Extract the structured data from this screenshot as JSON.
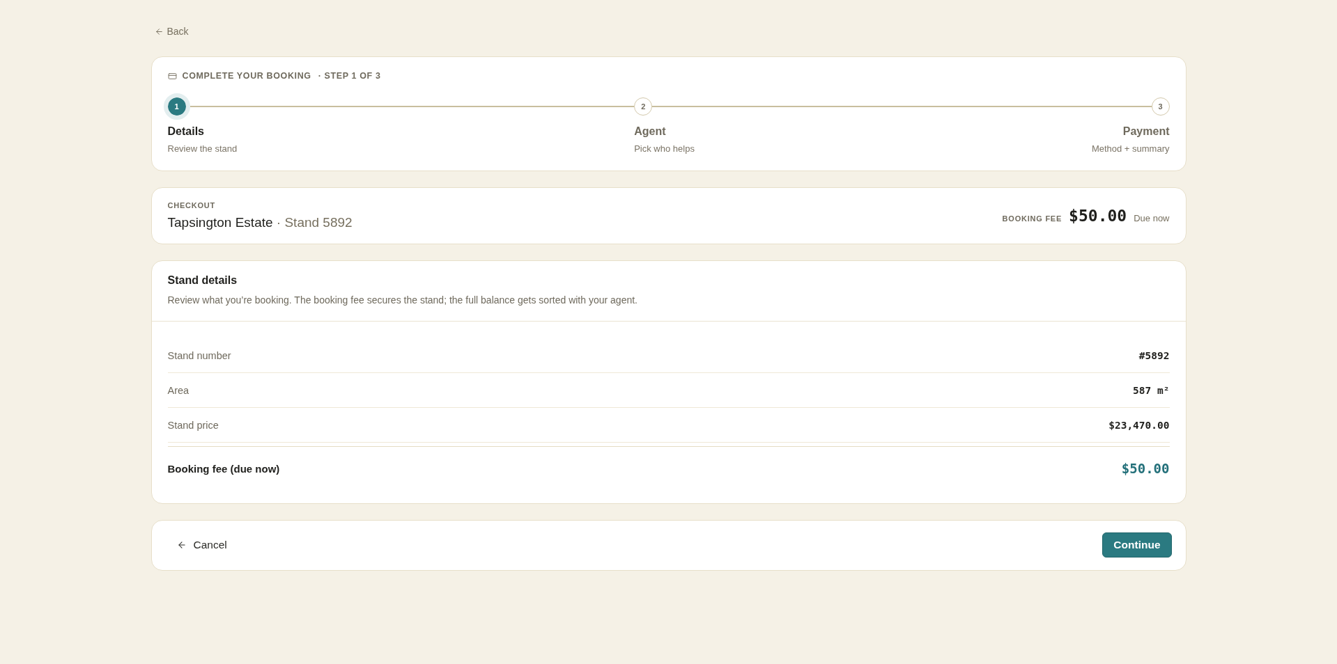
{
  "back_link": {
    "label": "Back"
  },
  "booking_header": {
    "title": "COMPLETE YOUR BOOKING",
    "step_note": "· STEP 1 OF 3"
  },
  "steps": [
    {
      "number": "1",
      "title": "Details",
      "subtitle": "Review the stand",
      "active": true
    },
    {
      "number": "2",
      "title": "Agent",
      "subtitle": "Pick who helps",
      "active": false
    },
    {
      "number": "3",
      "title": "Payment",
      "subtitle": "Method + summary",
      "active": false
    }
  ],
  "checkout": {
    "eyebrow": "CHECKOUT",
    "estate": "Tapsington Estate",
    "stand": "· Stand 5892",
    "fee_label": "BOOKING FEE",
    "fee_amount": "$50.00",
    "fee_note": "Due now"
  },
  "stand_details": {
    "title": "Stand details",
    "description": "Review what you’re booking. The booking fee secures the stand; the full balance gets sorted with your agent.",
    "rows": [
      {
        "kind": "item",
        "label": "Stand number",
        "value": "#5892"
      },
      {
        "kind": "item",
        "label": "Area",
        "value": "587 m²"
      },
      {
        "kind": "item",
        "label": "Stand price",
        "value": "$23,470.00"
      },
      {
        "kind": "total",
        "label": "Booking fee (due now)",
        "value": "$50.00"
      }
    ]
  },
  "footer": {
    "cancel": "Cancel",
    "continue": "Continue"
  }
}
